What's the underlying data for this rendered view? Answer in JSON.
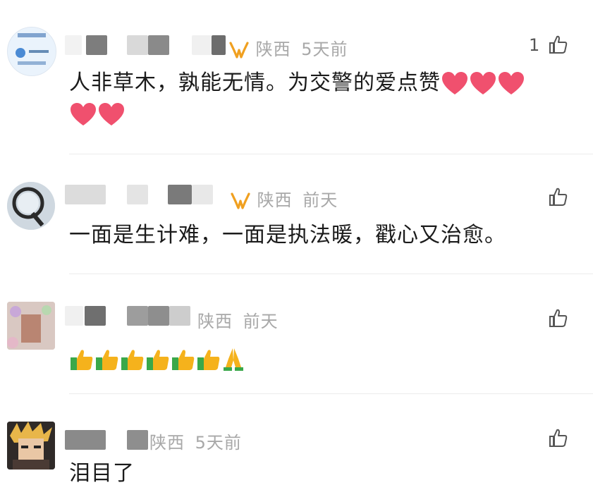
{
  "comments": [
    {
      "location": "陕西",
      "time": "5天前",
      "like_count": "1",
      "text": "人非草木，孰能无情。为交警的爱点赞",
      "badge": "vip-badge-icon",
      "emoji": "heart"
    },
    {
      "location": "陕西",
      "time": "前天",
      "like_count": "",
      "text": "一面是生计难，一面是执法暖，戳心又治愈。",
      "badge": "vip-badge-icon"
    },
    {
      "location": "陕西",
      "time": "前天",
      "like_count": "",
      "text": "",
      "emoji": "thumbs-up"
    },
    {
      "location": "陕西",
      "time": "5天前",
      "like_count": "",
      "text": "泪目了"
    }
  ],
  "colors": {
    "meta": "#a8a8a8",
    "text": "#1b1b1b",
    "heart": "#f0506e",
    "vip": "#f0a020",
    "thumb": "#f5b21c",
    "thumb_cuff": "#3aa84a"
  }
}
